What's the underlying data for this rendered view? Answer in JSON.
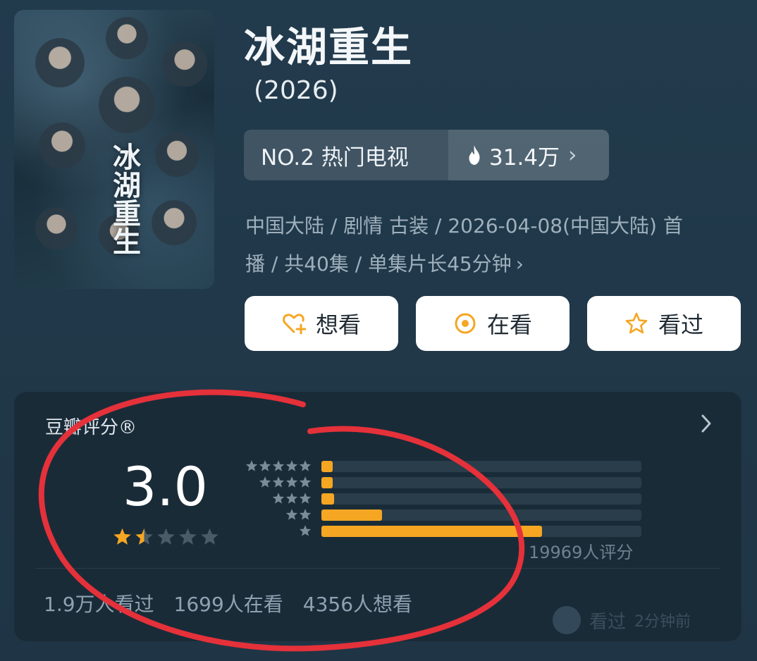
{
  "header": {
    "title": "冰湖重生",
    "year": "(2026)",
    "poster_title": "冰湖重生"
  },
  "rank": {
    "label": "NO.2 热门电视",
    "heat": "31.4万",
    "chevron": "›"
  },
  "meta": {
    "line1": "中国大陆 / 剧情 古装 / 2026-04-08(中国大陆) 首",
    "line2": "播 / 共40集 / 单集片长45分钟",
    "chevron": "›"
  },
  "actions": {
    "want": "想看",
    "watching": "在看",
    "watched": "看过"
  },
  "rating": {
    "title": "豆瓣评分®",
    "score": "3.0",
    "score_stars_fraction": 0.3,
    "distribution_percent": [
      3,
      3,
      4,
      19,
      69
    ],
    "raters": "19969人评分",
    "stats": {
      "watched_count": "1.9万人看过",
      "watching_count": "1699人在看",
      "want_count": "4356人想看"
    },
    "recent": {
      "label": "看过",
      "time": "2分钟前"
    }
  },
  "colors": {
    "accent": "#f5a623",
    "annotation": "#e5313a",
    "background": "#213a4b"
  },
  "icons": {
    "want": "heart-plus-icon",
    "watching": "target-circle-icon",
    "watched": "star-outline-icon",
    "heat": "flame-icon"
  }
}
